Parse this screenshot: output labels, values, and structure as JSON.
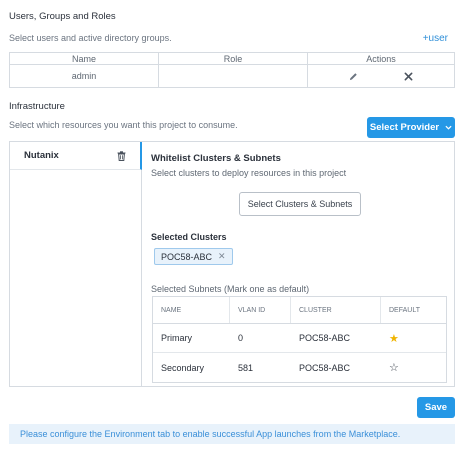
{
  "users": {
    "title": "Users, Groups and Roles",
    "description": "Select users and active directory groups.",
    "add_user_label": "+user",
    "columns": [
      "Name",
      "Role",
      "Actions"
    ],
    "rows": [
      {
        "name": "admin",
        "role": ""
      }
    ]
  },
  "infrastructure": {
    "title": "Infrastructure",
    "description": "Select which resources you want this project to consume.",
    "select_provider_label": "Select Provider",
    "providers": [
      {
        "name": "Nutanix"
      }
    ],
    "whitelist": {
      "title": "Whitelist Clusters & Subnets",
      "description": "Select clusters to deploy resources in this project",
      "button_label": "Select Clusters & Subnets",
      "selected_clusters_label": "Selected Clusters",
      "selected_clusters": [
        "POC58-ABC"
      ],
      "selected_subnets_label": "Selected Subnets (Mark one as default)",
      "subnet_columns": [
        "NAME",
        "VLAN ID",
        "CLUSTER",
        "DEFAULT"
      ],
      "subnets": [
        {
          "name": "Primary",
          "vlan_id": "0",
          "cluster": "POC58-ABC",
          "default": true
        },
        {
          "name": "Secondary",
          "vlan_id": "581",
          "cluster": "POC58-ABC",
          "default": false
        }
      ]
    }
  },
  "save_label": "Save",
  "notice": "Please configure the Environment tab to enable successful App launches from the Marketplace.",
  "colors": {
    "accent": "#2598e6",
    "star_active": "#f0b400",
    "notice_bg": "#e8f2fb"
  }
}
